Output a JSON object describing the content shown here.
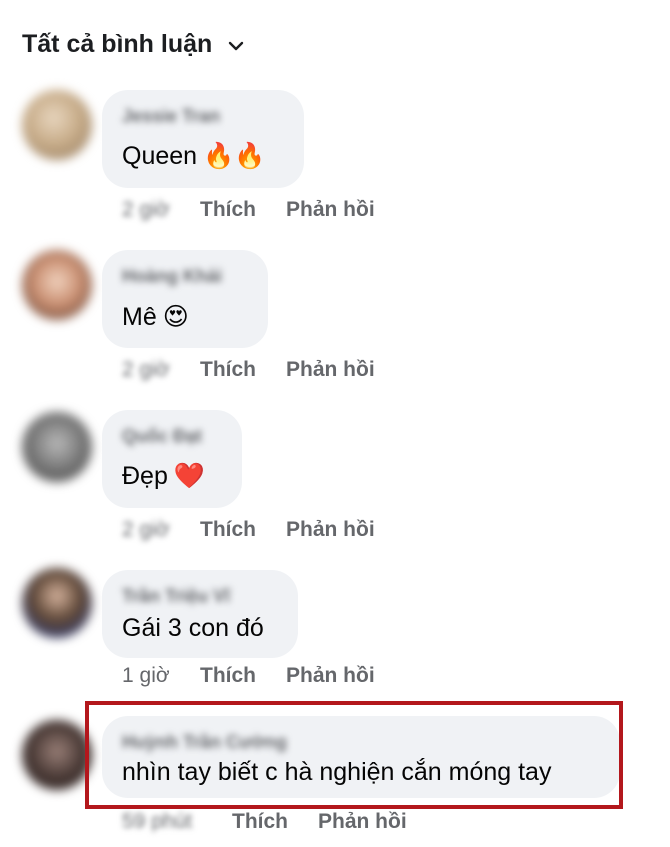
{
  "header": {
    "title": "Tất cả bình luận"
  },
  "comments": [
    {
      "author": "Jessie Tran",
      "text": "Queen",
      "emoji": "🔥🔥",
      "time": "2 giờ",
      "like_label": "Thích",
      "reply_label": "Phản hồi"
    },
    {
      "author": "Hoàng Khải",
      "text": "Mê",
      "emoji": "😍",
      "time": "2 giờ",
      "like_label": "Thích",
      "reply_label": "Phản hồi"
    },
    {
      "author": "Quốc Đạt",
      "text": "Đẹp",
      "emoji": "❤️",
      "time": "2 giờ",
      "like_label": "Thích",
      "reply_label": "Phản hồi"
    },
    {
      "author": "Trần Triệu Vĩ",
      "text": "Gái 3 con đó",
      "emoji": "",
      "time": "1 giờ",
      "like_label": "Thích",
      "reply_label": "Phản hồi"
    },
    {
      "author": "Huỳnh Trần Cường",
      "text": "nhìn tay biết c hà nghiện cắn móng tay",
      "emoji": "",
      "time": "59 phút",
      "like_label": "Thích",
      "reply_label": "Phản hồi"
    }
  ],
  "colors": {
    "highlight_border": "#b3171c",
    "bubble": "#f0f2f5",
    "muted_text": "#65676b"
  }
}
